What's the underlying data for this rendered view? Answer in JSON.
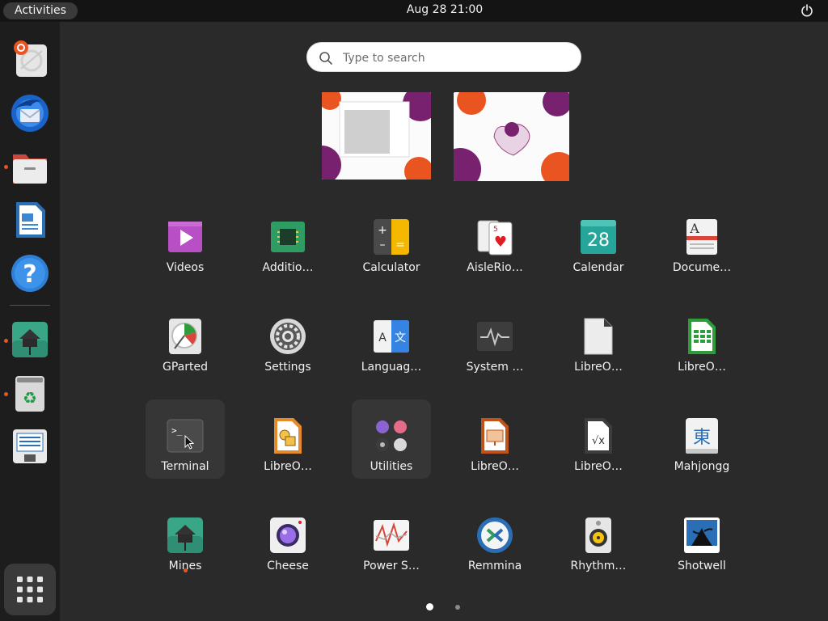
{
  "topbar": {
    "activities_label": "Activities",
    "clock": "Aug 28  21:00",
    "power_icon": "power-icon"
  },
  "search": {
    "placeholder": "Type to search",
    "value": ""
  },
  "dock": {
    "items": [
      {
        "name": "Help (Ubuntu)",
        "icon": "lifebuoy-icon"
      },
      {
        "name": "Thunderbird Mail",
        "icon": "thunderbird-icon"
      },
      {
        "name": "Files",
        "icon": "folder-icon",
        "running": true
      },
      {
        "name": "LibreOffice Writer",
        "icon": "writer-icon"
      },
      {
        "name": "Help",
        "icon": "help-icon"
      },
      {
        "name": "Mines",
        "icon": "mines-icon",
        "running": true
      },
      {
        "name": "Trash",
        "icon": "trash-icon",
        "running": true
      },
      {
        "name": "Document Viewer",
        "icon": "document-icon"
      },
      {
        "name": "Show Applications",
        "icon": "app-grid-icon"
      }
    ]
  },
  "apps": [
    {
      "label": "Videos",
      "icon": "videos-icon"
    },
    {
      "label": "Additio…",
      "icon": "chip-icon"
    },
    {
      "label": "Calculator",
      "icon": "calculator-icon"
    },
    {
      "label": "AisleRio…",
      "icon": "cards-icon"
    },
    {
      "label": "Calendar",
      "icon": "calendar-icon",
      "day": "28"
    },
    {
      "label": "Docume…",
      "icon": "document-viewer-icon"
    },
    {
      "label": "GParted",
      "icon": "gparted-icon"
    },
    {
      "label": "Settings",
      "icon": "settings-icon"
    },
    {
      "label": "Languag…",
      "icon": "language-icon"
    },
    {
      "label": "System …",
      "icon": "system-monitor-icon"
    },
    {
      "label": "LibreO…",
      "icon": "libreoffice-icon"
    },
    {
      "label": "LibreO…",
      "icon": "calc-icon"
    },
    {
      "label": "Terminal",
      "icon": "terminal-icon",
      "highlighted": true
    },
    {
      "label": "LibreO…",
      "icon": "draw-icon"
    },
    {
      "label": "Utilities",
      "icon": "utilities-folder-icon",
      "highlighted": true
    },
    {
      "label": "LibreO…",
      "icon": "impress-icon"
    },
    {
      "label": "LibreO…",
      "icon": "math-icon"
    },
    {
      "label": "Mahjongg",
      "icon": "mahjongg-icon"
    },
    {
      "label": "Mines",
      "icon": "mines-icon",
      "running": true
    },
    {
      "label": "Cheese",
      "icon": "cheese-icon"
    },
    {
      "label": "Power S…",
      "icon": "power-stats-icon"
    },
    {
      "label": "Remmina",
      "icon": "remmina-icon"
    },
    {
      "label": "Rhythm…",
      "icon": "rhythmbox-icon"
    },
    {
      "label": "Shotwell",
      "icon": "shotwell-icon"
    }
  ],
  "glyphs": {
    "calc_plus": "+",
    "calc_minus": "–",
    "calc_equals": "=",
    "lang_a": "A",
    "lang_zh": "文",
    "mahjongg_char": "東",
    "terminal_prompt": ">_",
    "math_formula": "√x",
    "cards_rank": "5",
    "cards_suit": "♥",
    "document_letter": "A"
  },
  "pagination": {
    "pages": 2,
    "current": 1
  },
  "colors": {
    "accent": "#e95420",
    "background": "#2a2a2a",
    "dock": "#1d1d1d",
    "topbar": "#141414"
  }
}
